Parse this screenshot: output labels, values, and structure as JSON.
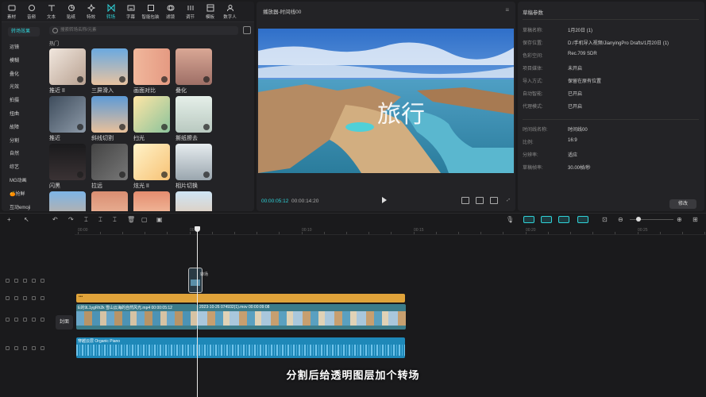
{
  "toolbar": {
    "items": [
      {
        "label": "素材",
        "icon": "media-icon"
      },
      {
        "label": "音频",
        "icon": "audio-icon"
      },
      {
        "label": "文本",
        "icon": "text-icon"
      },
      {
        "label": "贴纸",
        "icon": "sticker-icon"
      },
      {
        "label": "特效",
        "icon": "effects-icon"
      },
      {
        "label": "转场",
        "icon": "transition-icon",
        "active": true
      },
      {
        "label": "字幕",
        "icon": "caption-icon"
      },
      {
        "label": "智能包装",
        "icon": "smart-package-icon"
      },
      {
        "label": "滤镜",
        "icon": "filter-icon"
      },
      {
        "label": "调节",
        "icon": "adjust-icon"
      },
      {
        "label": "模板",
        "icon": "template-icon"
      },
      {
        "label": "数字人",
        "icon": "avatar-icon"
      }
    ]
  },
  "categories": {
    "header": "转场效果",
    "items": [
      "运镜",
      "模糊",
      "叠化",
      "光效",
      "拍摄",
      "扭曲",
      "故障",
      "分割",
      "自然",
      "综艺",
      "MG动画",
      "🍊抢鲜",
      "互动emoji"
    ]
  },
  "search": {
    "placeholder": "搜索转场名称/元素"
  },
  "grid": {
    "section": "热门",
    "tiles": [
      {
        "name": "推近 II"
      },
      {
        "name": "三屏滑入"
      },
      {
        "name": "画面对比"
      },
      {
        "name": "叠化"
      },
      {
        "name": "推近"
      },
      {
        "name": "斜线切割"
      },
      {
        "name": "扫光"
      },
      {
        "name": "撕纸擦去"
      },
      {
        "name": "闪黑"
      },
      {
        "name": "拉远"
      },
      {
        "name": "炫光 II"
      },
      {
        "name": "相片切换"
      },
      {
        "name": ""
      },
      {
        "name": ""
      },
      {
        "name": ""
      },
      {
        "name": ""
      }
    ]
  },
  "player": {
    "title": "播放器-时间线00",
    "current_time": "00:00:05:12",
    "total_time": "00:00:14:20",
    "overlay_text": "旅行"
  },
  "draft": {
    "title": "草稿参数",
    "rows1": [
      {
        "k": "草稿名称:",
        "v": "1月20日 (1)"
      },
      {
        "k": "保存位置:",
        "v": "D:/手机导入视频/JianyingPro Drafts/1月20日 (1)"
      },
      {
        "k": "色彩空间:",
        "v": "Rec.709 SDR"
      },
      {
        "k": "项目媒体:",
        "v": "未开启"
      },
      {
        "k": "导入方式:",
        "v": "保留在原有位置"
      },
      {
        "k": "自动智能:",
        "v": "已开启"
      },
      {
        "k": "代理模式:",
        "v": "已开启"
      }
    ],
    "rows2": [
      {
        "k": "时间线名称:",
        "v": "时间线00"
      },
      {
        "k": "比例:",
        "v": "16:9"
      },
      {
        "k": "分辨率:",
        "v": "适应"
      },
      {
        "k": "草稿帧率:",
        "v": "30.00帧/秒"
      }
    ],
    "edit_label": "修改"
  },
  "timeline": {
    "ruler": [
      "00:00",
      "00:05",
      "00:10",
      "00:15",
      "00:20",
      "00:25"
    ],
    "cover_label": "封面",
    "clip1": "E的9L1ygRh2k  雪山云海的自然风光.mp4  00:00:05:12",
    "clip2": "2023-10-26 074932(1).mov  00:00:09:08",
    "audio": "穿越云层  Organic Piano",
    "transition_label": "转场"
  },
  "subtitle": "分割后给透明图层加个转场",
  "colors": {
    "accent": "#2fd3d9",
    "overlay_track": "#e0a33a",
    "audio_track": "#1e88b8"
  }
}
